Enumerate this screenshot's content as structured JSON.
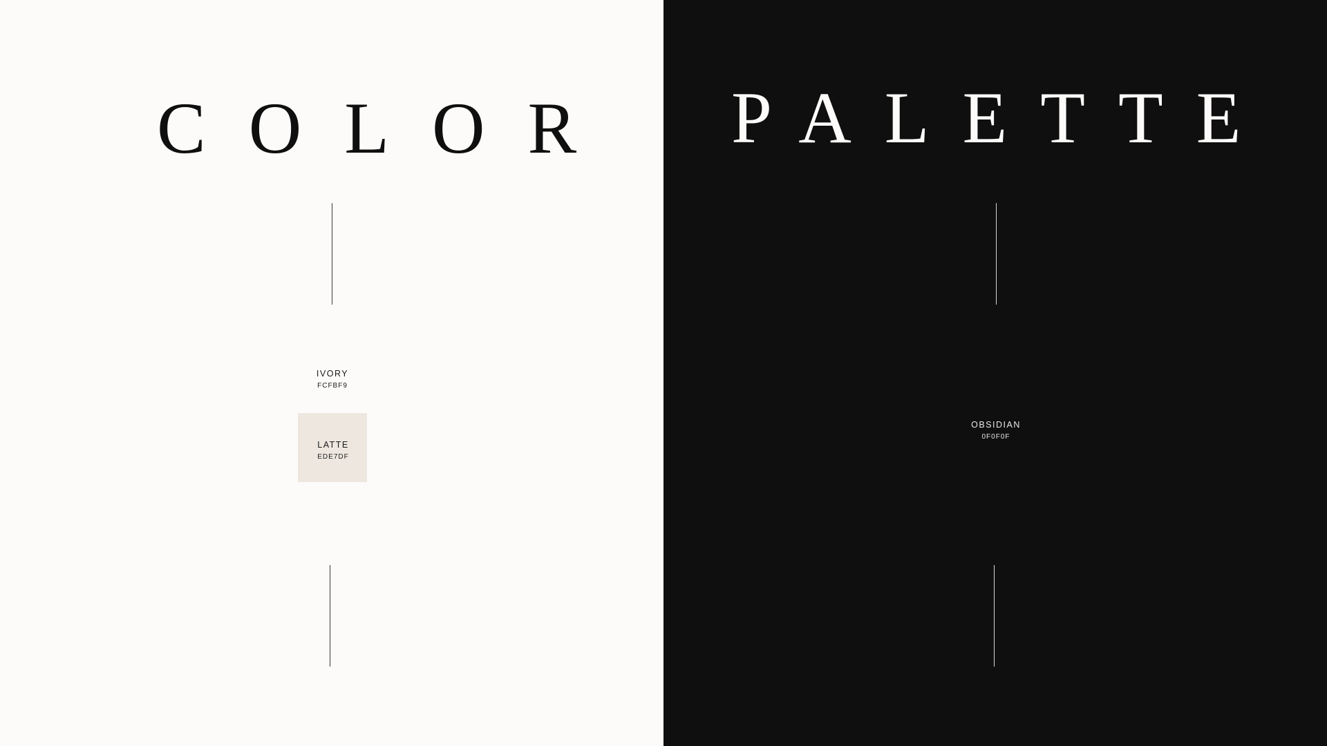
{
  "left": {
    "title": "COLOR",
    "background": "#FCFBF9",
    "swatches": [
      {
        "name": "IVORY",
        "hex": "FCFBF9",
        "color": "#FCFBF9"
      },
      {
        "name": "LATTE",
        "hex": "EDE7DF",
        "color": "#EDE7DF"
      }
    ]
  },
  "right": {
    "title": "PALETTE",
    "background": "#0F0F0F",
    "swatches": [
      {
        "name": "OBSIDIAN",
        "hex": "0F0F0F",
        "color": "#0F0F0F"
      }
    ]
  }
}
